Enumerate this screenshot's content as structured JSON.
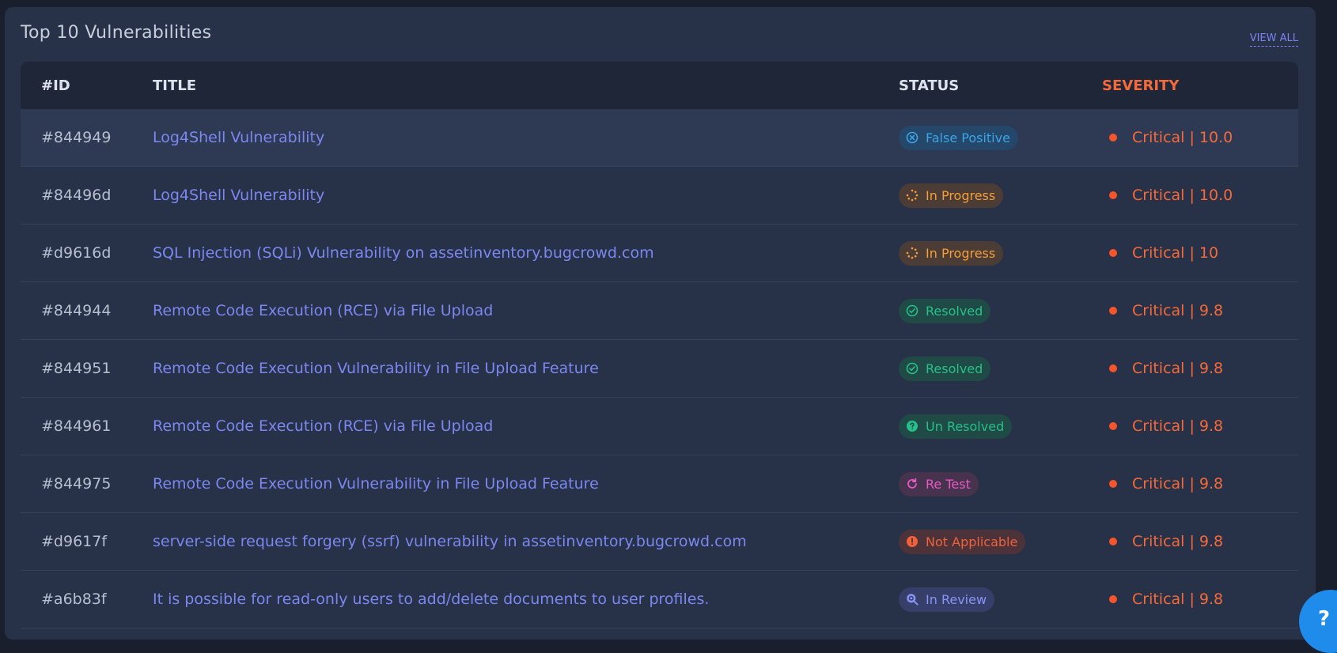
{
  "card": {
    "title": "Top 10 Vulnerabilities",
    "view_all": "VIEW ALL"
  },
  "columns": {
    "id": "#ID",
    "title": "TITLE",
    "status": "STATUS",
    "severity": "SEVERITY"
  },
  "rows": [
    {
      "id": "#844949",
      "title": "Log4Shell Vulnerability",
      "status": "False Positive",
      "severity": "Critical | 10.0"
    },
    {
      "id": "#84496d",
      "title": "Log4Shell Vulnerability",
      "status": "In Progress",
      "severity": "Critical | 10.0"
    },
    {
      "id": "#d9616d",
      "title": "SQL Injection (SQLi) Vulnerability on assetinventory.bugcrowd.com",
      "status": "In Progress",
      "severity": "Critical | 10"
    },
    {
      "id": "#844944",
      "title": "Remote Code Execution (RCE) via File Upload",
      "status": "Resolved",
      "severity": "Critical | 9.8"
    },
    {
      "id": "#844951",
      "title": "Remote Code Execution Vulnerability in File Upload Feature",
      "status": "Resolved",
      "severity": "Critical | 9.8"
    },
    {
      "id": "#844961",
      "title": "Remote Code Execution (RCE) via File Upload",
      "status": "Un Resolved",
      "severity": "Critical | 9.8"
    },
    {
      "id": "#844975",
      "title": "Remote Code Execution Vulnerability in File Upload Feature",
      "status": "Re Test",
      "severity": "Critical | 9.8"
    },
    {
      "id": "#d9617f",
      "title": "server-side request forgery (ssrf) vulnerability in assetinventory.bugcrowd.com",
      "status": "Not Applicable",
      "severity": "Critical | 9.8"
    },
    {
      "id": "#a6b83f",
      "title": "It is possible for read-only users to add/delete documents to user profiles.",
      "status": "In Review",
      "severity": "Critical | 9.8"
    }
  ],
  "help_button": "?"
}
